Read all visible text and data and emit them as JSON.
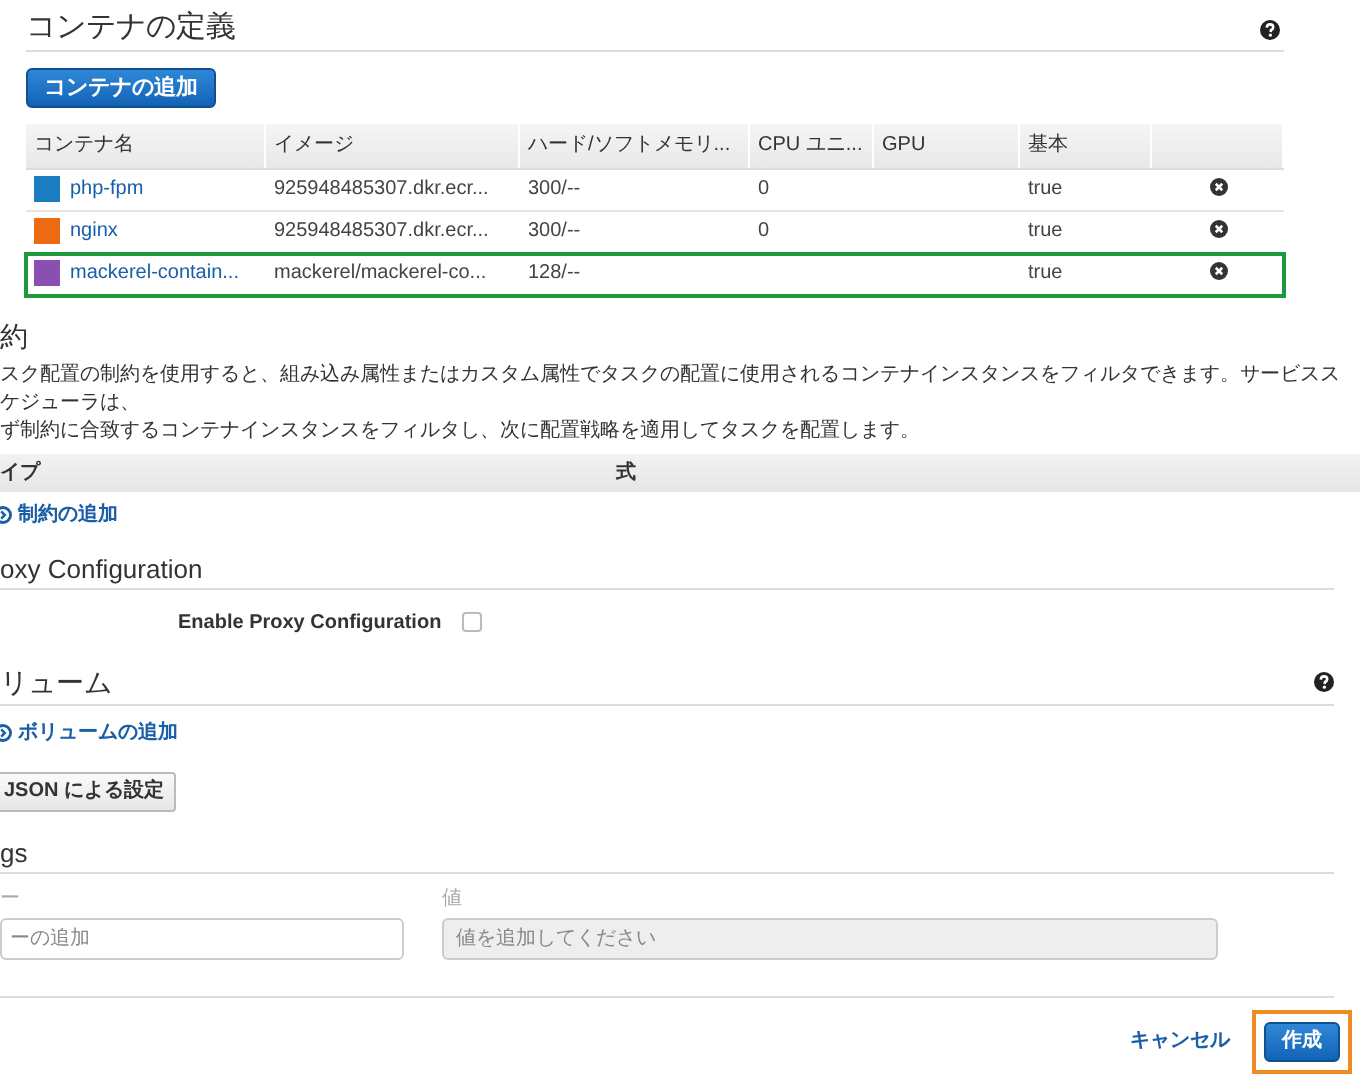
{
  "container_section": {
    "title": "コンテナの定義",
    "add_button": "コンテナの追加",
    "table": {
      "columns": [
        "コンテナ名",
        "イメージ",
        "ハード/ソフトメモリ...",
        "CPU ユニ...",
        "GPU",
        "基本",
        ""
      ],
      "rows": [
        {
          "name": "php-fpm",
          "color": "#1a7dc0",
          "image": "925948485307.dkr.ecr...",
          "memory": "300/--",
          "cpu": "0",
          "gpu": "",
          "essential": "true",
          "highlighted": false
        },
        {
          "name": "nginx",
          "color": "#ec6b12",
          "image": "925948485307.dkr.ecr...",
          "memory": "300/--",
          "cpu": "0",
          "gpu": "",
          "essential": "true",
          "highlighted": false
        },
        {
          "name": "mackerel-contain...",
          "color": "#8a4fb0",
          "image": "mackerel/mackerel-co...",
          "memory": "128/--",
          "cpu": "",
          "gpu": "",
          "essential": "true",
          "highlighted": true
        }
      ]
    }
  },
  "constraints": {
    "title": "約",
    "description_lines": [
      "スク配置の制約を使用すると、組み込み属性またはカスタム属性でタスクの配置に使用されるコンテナインスタンスをフィルタできます。サービススケジューラは、",
      "ず制約に合致するコンテナインスタンスをフィルタし、次に配置戦略を適用してタスクを配置します。"
    ],
    "columns": [
      "イプ",
      "式"
    ],
    "add_link": "制約の追加"
  },
  "proxy": {
    "title": "oxy Configuration",
    "checkbox_label": "Enable Proxy Configuration",
    "checked": false
  },
  "volumes": {
    "title": "リューム",
    "add_link": "ボリュームの追加"
  },
  "json_button": "JSON による設定",
  "tags": {
    "title": "gs",
    "key_label": "ー",
    "key_placeholder": "ーの追加",
    "value_label": "値",
    "value_placeholder": "値を追加してください",
    "value_disabled": true
  },
  "footer": {
    "cancel": "キャンセル",
    "create": "作成"
  }
}
